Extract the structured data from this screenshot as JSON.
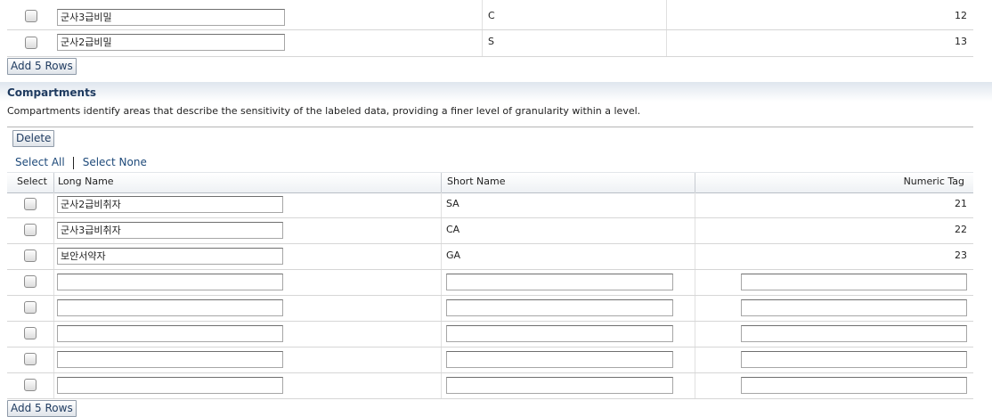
{
  "levels": {
    "rows": [
      {
        "long_name": "군사3급비밀",
        "short_name": "C",
        "numeric_tag": "12"
      },
      {
        "long_name": "군사2급비밀",
        "short_name": "S",
        "numeric_tag": "13"
      }
    ],
    "add_rows_label": "Add 5 Rows"
  },
  "compartments": {
    "title": "Compartments",
    "description": "Compartments identify areas that describe the sensitivity of the labeled data, providing a finer level of granularity within a level.",
    "delete_label": "Delete",
    "select_all_label": "Select All",
    "select_none_label": "Select None",
    "columns": {
      "select": "Select",
      "long_name": "Long Name",
      "short_name": "Short Name",
      "numeric_tag": "Numeric Tag"
    },
    "rows": [
      {
        "long_name": "군사2급비취자",
        "short_name": "SA",
        "numeric_tag": "21"
      },
      {
        "long_name": "군사3급비취자",
        "short_name": "CA",
        "numeric_tag": "22"
      },
      {
        "long_name": "보안서약자",
        "short_name": "GA",
        "numeric_tag": "23"
      }
    ],
    "add_rows_label": "Add 5 Rows"
  }
}
